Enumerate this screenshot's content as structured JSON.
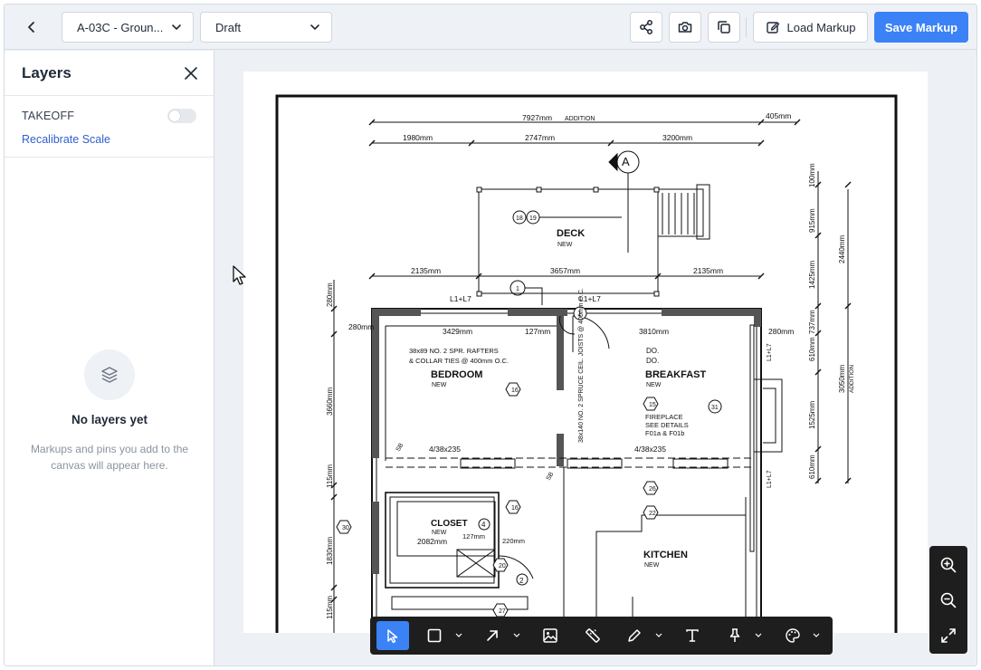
{
  "header": {
    "back_icon": "chevron-left-icon",
    "sheet_select": "A-03C - Groun...",
    "status_select": "Draft",
    "share_icon": "share-icon",
    "snapshot_icon": "camera-icon",
    "copy_icon": "copy-icon",
    "load_markup": "Load Markup",
    "save_markup": "Save Markup",
    "accent": "#3b82f6"
  },
  "sidebar": {
    "title": "Layers",
    "takeoff_label": "TAKEOFF",
    "takeoff_enabled": false,
    "recalibrate": "Recalibrate Scale",
    "empty_title": "No layers yet",
    "empty_text": "Markups and pins you add to the canvas will appear here."
  },
  "drawing": {
    "dims_top": [
      "7927mm",
      "ADDITION",
      "405mm",
      "1980mm",
      "2747mm",
      "3200mm"
    ],
    "dims_mid": [
      "2135mm",
      "3657mm",
      "2135mm"
    ],
    "dims_right": [
      "100mm",
      "915mm",
      "1425mm",
      "2440mm",
      "737mm",
      "610mm",
      "1525mm",
      "3050mm",
      "ADDITION",
      "610mm"
    ],
    "dims_left": [
      "280mm",
      "280mm",
      "3660mm",
      "115mm",
      "1830mm",
      "115mm"
    ],
    "section_mark": "A",
    "deck": "DECK",
    "deck_sub": "NEW",
    "tags_top": [
      "18",
      "19",
      "1"
    ],
    "lintel": "L1+L7",
    "bedroom_dim": "3429mm",
    "small_dim": "127mm",
    "breakfast_dim": "3810mm",
    "rafter_note_1": "38x89 NO. 2 SPR. RAFTERS",
    "rafter_note_2": "& COLLAR TIES @ 400mm O.C.",
    "bedroom": "BEDROOM",
    "bedroom_sub": "NEW",
    "joist_note": "38x140 NO. 2 SPRUCE CEIL. JOISTS @ 400mm O.C.",
    "do_1": "DO.",
    "do_2": "DO.",
    "breakfast": "BREAKFAST",
    "breakfast_sub": "NEW",
    "fireplace_1": "FIREPLACE",
    "fireplace_2": "SEE DETAILS",
    "fireplace_3": "F01a & F01b",
    "beam_left": "4/38x235",
    "beam_right": "4/38x235",
    "sb": "SB",
    "closet": "CLOSET",
    "closet_sub": "NEW",
    "closet_dim": "2082mm",
    "closet_dim2": "127mm",
    "closet_dim3": "220mm",
    "kitchen": "KITCHEN",
    "kitchen_sub": "NEW",
    "tags": [
      "16",
      "15",
      "31",
      "16",
      "26",
      "22",
      "30",
      "20",
      "2",
      "27",
      "4",
      "1",
      "16"
    ]
  },
  "toolbar": {
    "tools": [
      {
        "name": "select-tool",
        "icon": "cursor-icon",
        "active": true
      },
      {
        "name": "rectangle-tool",
        "icon": "square-icon",
        "active": false
      },
      {
        "name": "arrow-tool",
        "icon": "arrow-icon",
        "active": false
      },
      {
        "name": "image-tool",
        "icon": "image-icon",
        "active": false
      },
      {
        "name": "measure-tool",
        "icon": "ruler-icon",
        "active": false
      },
      {
        "name": "highlighter-tool",
        "icon": "pen-icon",
        "active": false
      },
      {
        "name": "text-tool",
        "icon": "text-icon",
        "active": false
      },
      {
        "name": "pin-tool",
        "icon": "pin-icon",
        "active": false
      },
      {
        "name": "color-tool",
        "icon": "palette-icon",
        "active": false
      }
    ]
  },
  "zoom": {
    "zoom_in": "zoom-in-icon",
    "zoom_out": "zoom-out-icon",
    "fit": "expand-icon"
  }
}
